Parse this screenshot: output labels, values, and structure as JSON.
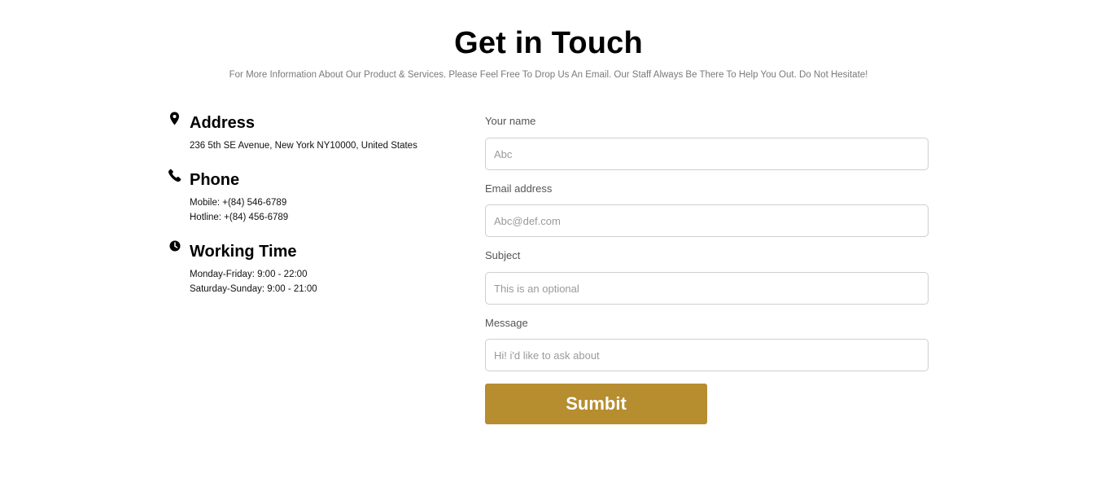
{
  "header": {
    "title": "Get in Touch",
    "subtitle": "For More Information About Our Product & Services. Please Feel Free To Drop Us An Email. Our Staff Always Be There To Help You Out. Do Not Hesitate!"
  },
  "contact": {
    "address": {
      "icon": "location-pin-icon",
      "title": "Address",
      "lines": [
        "236 5th SE Avenue, New York NY10000, United States"
      ]
    },
    "phone": {
      "icon": "phone-icon",
      "title": "Phone",
      "lines": [
        "Mobile: +(84) 546-6789",
        "Hotline: +(84) 456-6789"
      ]
    },
    "working_time": {
      "icon": "clock-icon",
      "title": "Working Time",
      "lines": [
        "Monday-Friday: 9:00 - 22:00",
        "Saturday-Sunday: 9:00 - 21:00"
      ]
    }
  },
  "form": {
    "name": {
      "label": "Your name",
      "placeholder": "Abc",
      "value": ""
    },
    "email": {
      "label": "Email address",
      "placeholder": "Abc@def.com",
      "value": ""
    },
    "subject": {
      "label": "Subject",
      "placeholder": "This is an optional",
      "value": ""
    },
    "message": {
      "label": "Message",
      "placeholder": "Hi! i'd like to ask about",
      "value": ""
    },
    "submit_label": "Sumbit"
  },
  "colors": {
    "accent": "#b68d2f",
    "input_border": "#cfcfcf",
    "subtitle": "#7a7a7a"
  }
}
